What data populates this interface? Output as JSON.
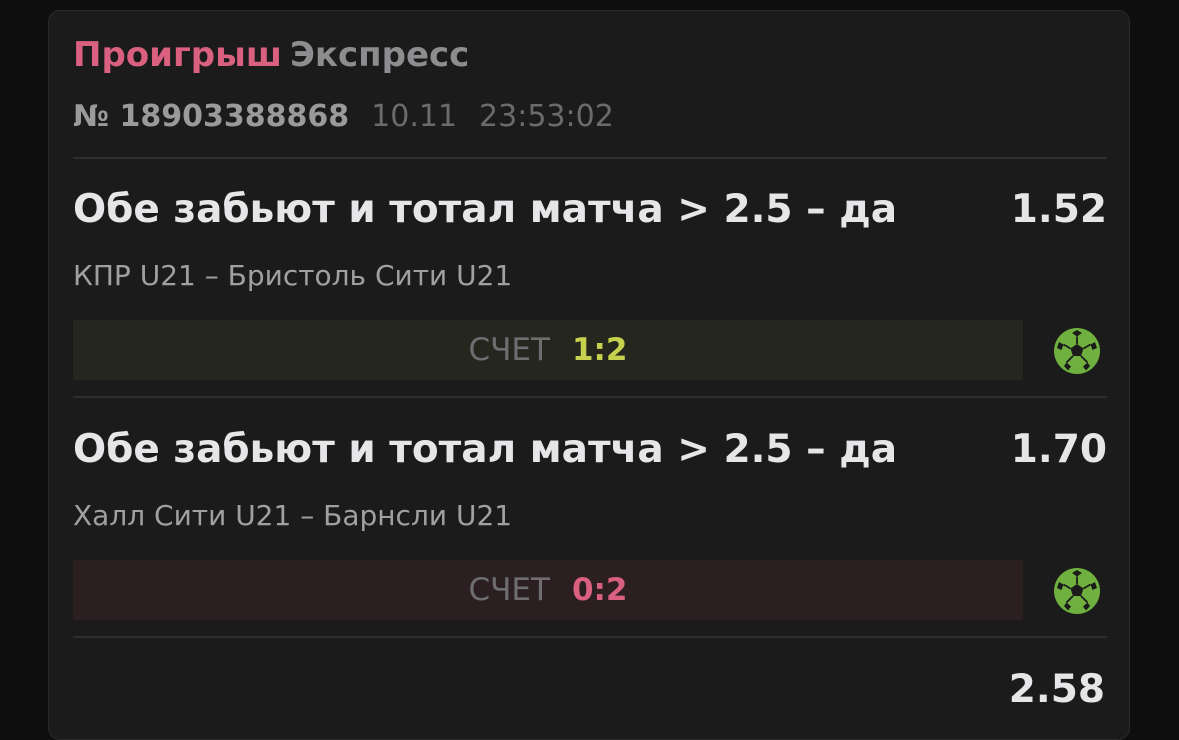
{
  "bet": {
    "status": "Проигрыш",
    "type": "Экспресс",
    "number": "№ 18903388868",
    "date": "10.11",
    "time": "23:53:02",
    "total_odds": "2.58"
  },
  "events": [
    {
      "market": "Обе забьют и тотал матча > 2.5 – да",
      "odds": "1.52",
      "teams": "КПР U21 – Бристоль Сити U21",
      "score_label": "СЧЕТ",
      "score": "1:2",
      "icon": "soccer-ball-icon",
      "score_color": "#c6d24e"
    },
    {
      "market": "Обе забьют и тотал матча > 2.5 – да",
      "odds": "1.70",
      "teams": "Халл Сити U21 – Барнсли U21",
      "score_label": "СЧЕТ",
      "score": "0:2",
      "icon": "soccer-ball-icon",
      "score_color": "#d9607f"
    }
  ],
  "colors": {
    "lost": "#d9607f",
    "ball_green": "#6fb03f"
  }
}
